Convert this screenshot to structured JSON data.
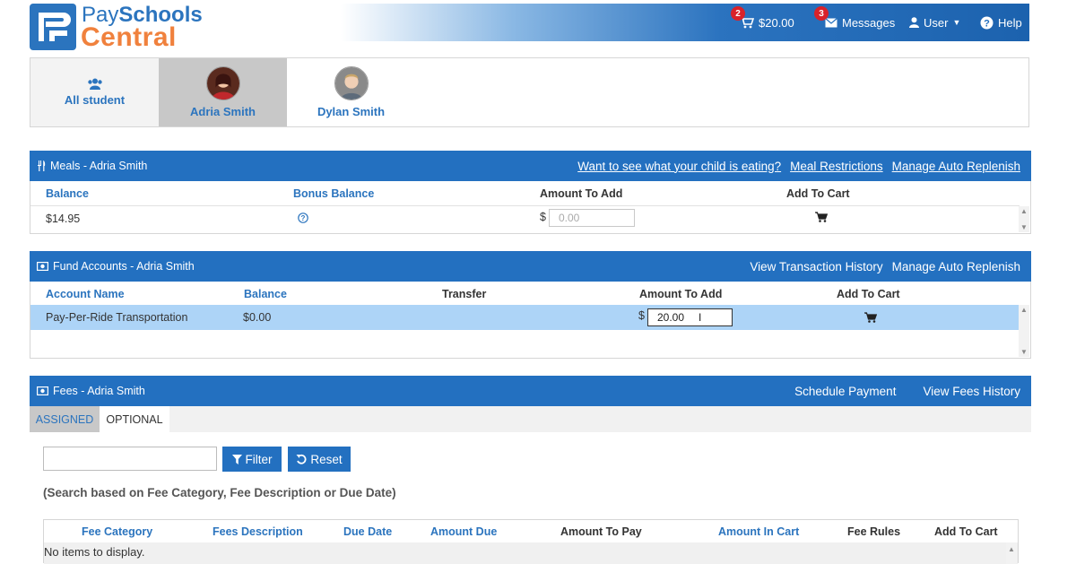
{
  "brand": {
    "pay": "Pay",
    "schools": "Schools",
    "central": "Central"
  },
  "header": {
    "cart_badge": "2",
    "cart_amount": "$20.00",
    "messages_badge": "3",
    "messages_label": "Messages",
    "user_label": "User",
    "help_label": "Help"
  },
  "students": {
    "all_label": "All student",
    "items": [
      {
        "name": "Adria Smith"
      },
      {
        "name": "Dylan Smith"
      }
    ]
  },
  "meals": {
    "title": "Meals - Adria Smith",
    "links": [
      "Want to see what your child is eating?",
      "Meal Restrictions",
      "Manage Auto Replenish"
    ],
    "columns": [
      "Balance",
      "Bonus Balance",
      "Amount To Add",
      "Add To Cart"
    ],
    "row": {
      "balance": "$14.95",
      "currency": "$",
      "amount_placeholder": "0.00"
    }
  },
  "funds": {
    "title": "Fund Accounts - Adria Smith",
    "links": [
      "View Transaction History",
      "Manage Auto Replenish"
    ],
    "columns": [
      "Account Name",
      "Balance",
      "Transfer",
      "Amount To Add",
      "Add To Cart"
    ],
    "row": {
      "account": "Pay-Per-Ride Transportation",
      "balance": "$0.00",
      "currency": "$",
      "amount_value": "20.00"
    }
  },
  "fees": {
    "title": "Fees - Adria Smith",
    "links": [
      "Schedule Payment",
      "View Fees History"
    ],
    "tabs": [
      "ASSIGNED",
      "OPTIONAL"
    ],
    "filter_label": "Filter",
    "reset_label": "Reset",
    "search_hint": "(Search based on Fee Category, Fee Description or Due Date)",
    "columns": [
      "Fee Category",
      "Fees Description",
      "Due Date",
      "Amount Due",
      "Amount To Pay",
      "Amount In Cart",
      "Fee Rules",
      "Add To Cart"
    ],
    "empty_text": "No items to display."
  },
  "colors": {
    "primary": "#2370c0",
    "accent": "#f0813d",
    "badge": "#d9222a",
    "row_highlight": "#add4f7"
  }
}
